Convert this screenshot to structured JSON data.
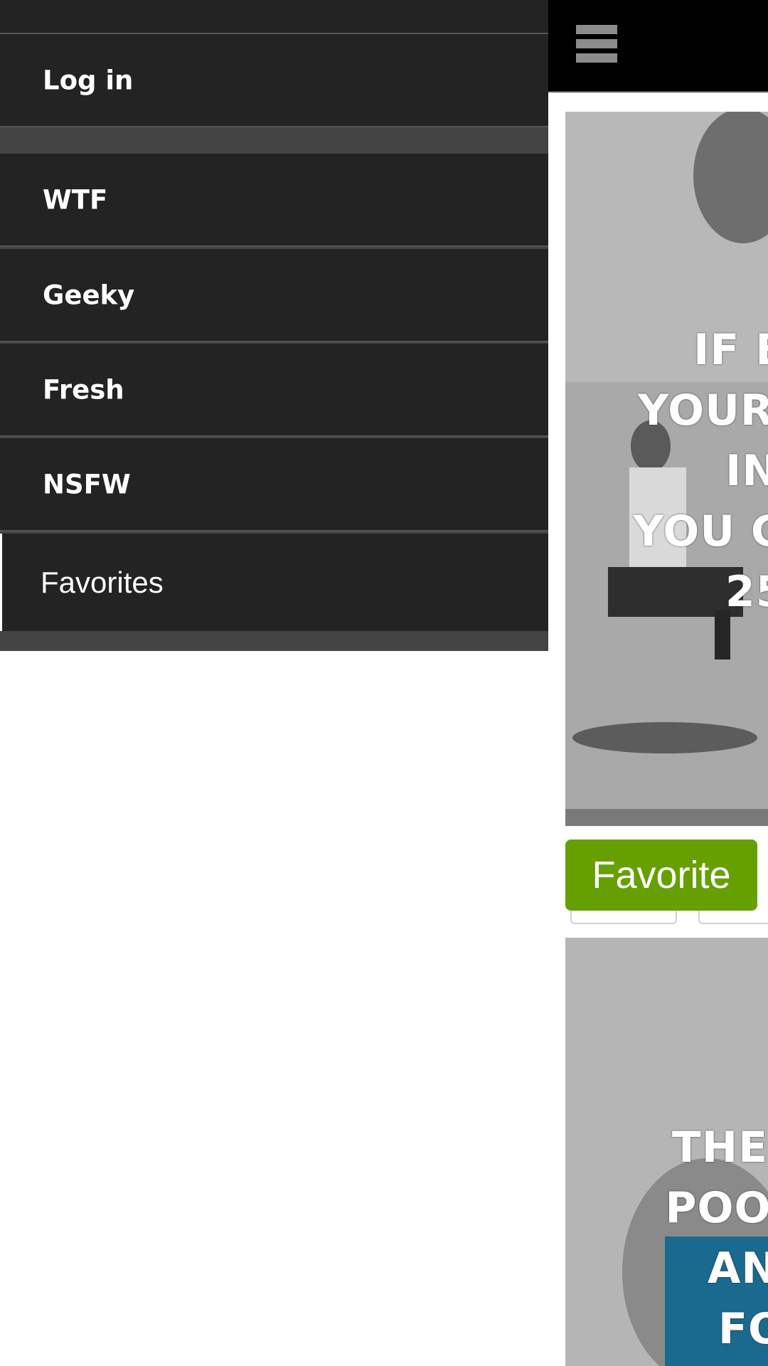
{
  "drawer": {
    "items": [
      {
        "id": "login",
        "label": "Log in"
      },
      {
        "id": "wtf",
        "label": "WTF"
      },
      {
        "id": "geeky",
        "label": "Geeky"
      },
      {
        "id": "fresh",
        "label": "Fresh"
      },
      {
        "id": "nsfw",
        "label": "NSFW"
      },
      {
        "id": "favorites",
        "label": "Favorites"
      }
    ]
  },
  "topbar": {
    "menu_icon": "hamburger-menu-icon"
  },
  "posts": [
    {
      "caption_lines": [
        "IF E",
        "YOUR",
        "IN",
        "YOU C",
        "25"
      ]
    },
    {
      "caption_lines": [
        "THE",
        "POO",
        "AN",
        "FO"
      ]
    }
  ],
  "actions": {
    "favorite_label": "Favorite"
  },
  "colors": {
    "drawer_bg": "#232323",
    "favorite_green": "#66a000",
    "topbar_bg": "#000000",
    "caption_box_blue": "#1a6a8f"
  }
}
